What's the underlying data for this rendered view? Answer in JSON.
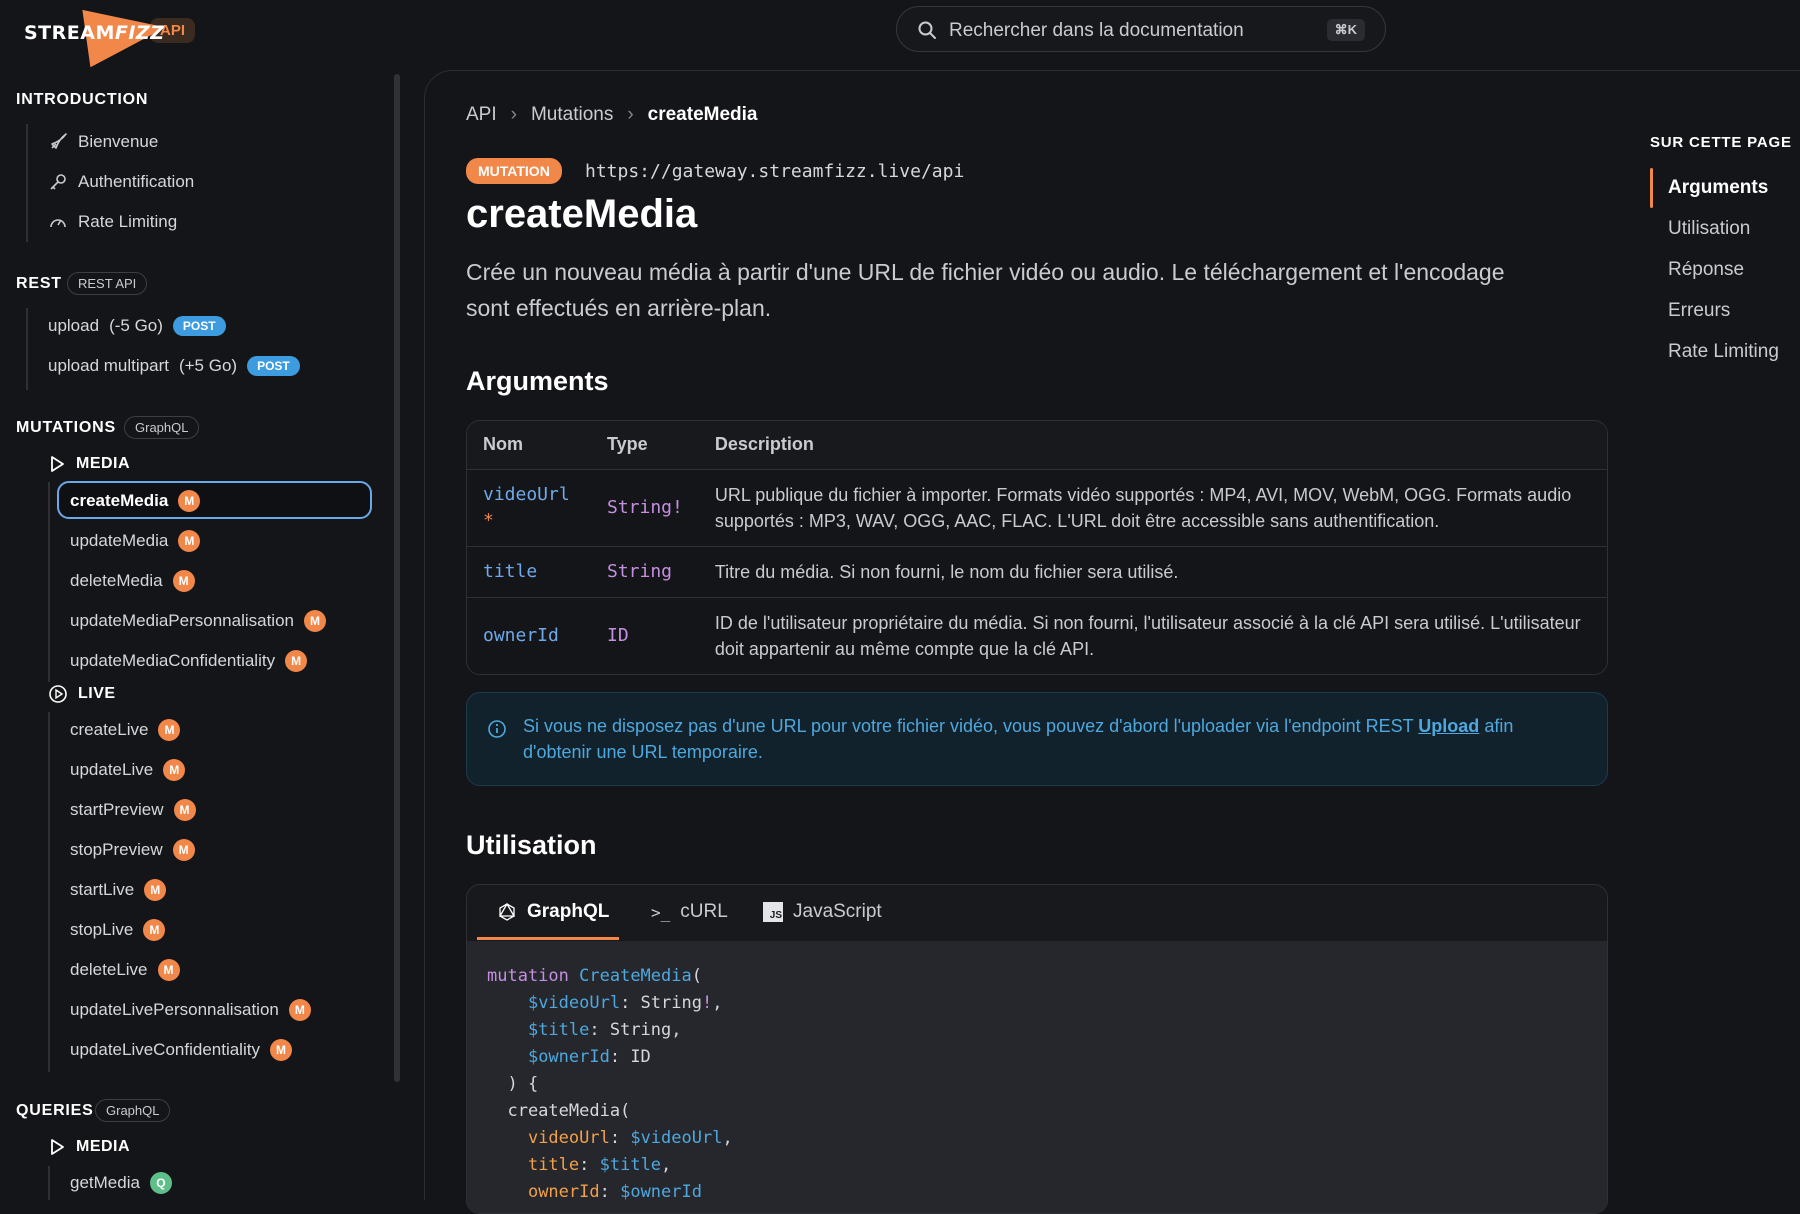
{
  "header": {
    "logo_text_a": "STREAM",
    "logo_text_b": "FIZZ",
    "api_badge": "API",
    "search_placeholder": "Rechercher dans la documentation",
    "search_shortcut": "⌘K"
  },
  "sidebar": {
    "introduction": {
      "title": "INTRODUCTION",
      "items": [
        {
          "label": "Bienvenue",
          "icon": "rocket-icon"
        },
        {
          "label": "Authentification",
          "icon": "key-icon"
        },
        {
          "label": "Rate Limiting",
          "icon": "gauge-icon"
        }
      ]
    },
    "rest": {
      "title": "REST",
      "pill": "REST API",
      "items": [
        {
          "label": "upload",
          "note": "(-5 Go)",
          "badge": "POST"
        },
        {
          "label": "upload multipart",
          "note": "(+5 Go)",
          "badge": "POST"
        }
      ]
    },
    "mutations": {
      "title": "MUTATIONS",
      "pill": "GraphQL",
      "media_title": "MEDIA",
      "media_items": [
        "createMedia",
        "updateMedia",
        "deleteMedia",
        "updateMediaPersonnalisation",
        "updateMediaConfidentiality"
      ],
      "live_title": "LIVE",
      "live_items": [
        "createLive",
        "updateLive",
        "startPreview",
        "stopPreview",
        "startLive",
        "stopLive",
        "deleteLive",
        "updateLivePersonnalisation",
        "updateLiveConfidentiality"
      ],
      "badge": "M"
    },
    "queries": {
      "title": "QUERIES",
      "pill": "GraphQL",
      "media_title": "MEDIA",
      "items": [
        "getMedia"
      ],
      "badge": "Q"
    }
  },
  "breadcrumb": [
    "API",
    "Mutations",
    "createMedia"
  ],
  "main": {
    "badge": "MUTATION",
    "endpoint": "https://gateway.streamfizz.live/api",
    "title": "createMedia",
    "description": "Crée un nouveau média à partir d'une URL de fichier vidéo ou audio. Le téléchargement et l'encodage sont effectués en arrière-plan.",
    "arguments_heading": "Arguments",
    "table_headers": [
      "Nom",
      "Type",
      "Description"
    ],
    "arguments": [
      {
        "name": "videoUrl",
        "required": "*",
        "type": "String!",
        "description": "URL publique du fichier à importer. Formats vidéo supportés : MP4, AVI, MOV, WebM, OGG. Formats audio supportés : MP3, WAV, OGG, AAC, FLAC. L'URL doit être accessible sans authentification."
      },
      {
        "name": "title",
        "required": "",
        "type": "String",
        "description": "Titre du média. Si non fourni, le nom du fichier sera utilisé."
      },
      {
        "name": "ownerId",
        "required": "",
        "type": "ID",
        "description": "ID de l'utilisateur propriétaire du média. Si non fourni, l'utilisateur associé à la clé API sera utilisé. L'utilisateur doit appartenir au même compte que la clé API."
      }
    ],
    "info_text_a": "Si vous ne disposez pas d'une URL pour votre fichier vidéo, vous pouvez d'abord l'uploader via l'endpoint REST",
    "info_link": "Upload",
    "info_text_b": "afin d'obtenir une URL temporaire.",
    "usage_heading": "Utilisation",
    "tabs": [
      "GraphQL",
      "cURL",
      "JavaScript"
    ]
  },
  "toc": {
    "title": "SUR CETTE PAGE",
    "items": [
      "Arguments",
      "Utilisation",
      "Réponse",
      "Erreurs",
      "Rate Limiting"
    ]
  },
  "colors": {
    "accent": "#f2874a",
    "link": "#4ea8de",
    "background": "#141519"
  }
}
